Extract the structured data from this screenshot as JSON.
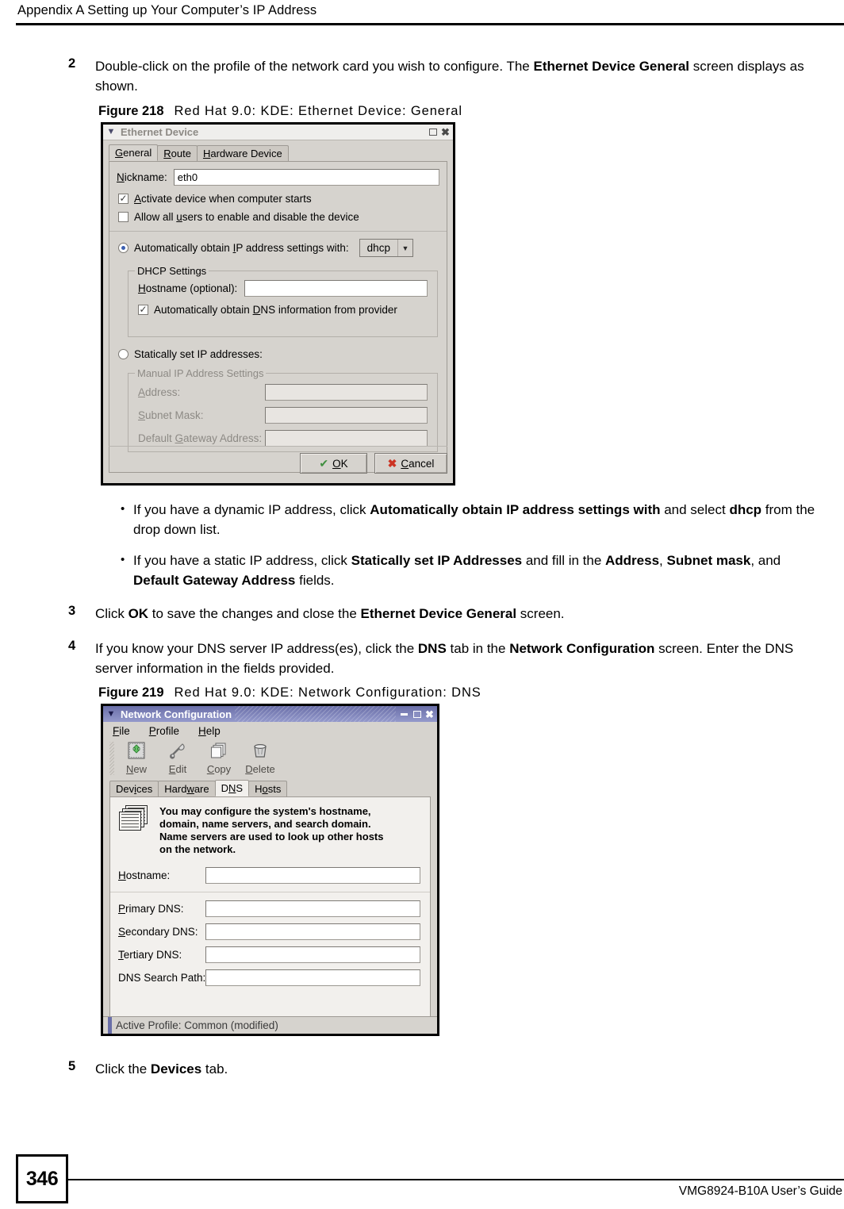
{
  "page": {
    "header": "Appendix A Setting up Your Computer’s IP Address",
    "footer_page_number": "346",
    "footer_guide": "VMG8924-B10A User’s Guide"
  },
  "steps": {
    "step2": {
      "number": "2",
      "text_1": "Double-click on the profile of the network card you wish to configure. The ",
      "bold_1": "Ethernet Device General",
      "text_2": " screen displays as shown."
    },
    "step3": {
      "number": "3",
      "text_1": "Click ",
      "bold_1": "OK",
      "text_2": " to save the changes and close the ",
      "bold_2": "Ethernet Device General",
      "text_3": " screen."
    },
    "step4": {
      "number": "4",
      "text_1": "If you know your DNS server IP address(es), click the ",
      "bold_1": "DNS",
      "text_2": " tab in the ",
      "bold_2": "Network Configuration",
      "text_3": " screen. Enter the DNS server information in the fields provided."
    },
    "step5": {
      "number": "5",
      "text_1": "Click the ",
      "bold_1": "Devices",
      "text_2": " tab."
    }
  },
  "bullets": [
    {
      "text_1": "If you have a dynamic IP address, click ",
      "bold_1": "Automatically obtain IP address settings with",
      "text_2": " and select ",
      "bold_2": "dhcp",
      "text_3": " from the drop down list."
    },
    {
      "text_1": "If you have a static IP address, click ",
      "bold_1": "Statically set IP Addresses",
      "text_2": " and fill in the  ",
      "bold_2": "Address",
      "text_3": ", ",
      "bold_3": "Subnet mask",
      "text_4": ", and ",
      "bold_4": "Default Gateway Address",
      "text_5": " fields."
    }
  ],
  "figures": {
    "fig218": {
      "label": "Figure 218",
      "caption": "Red Hat 9.0: KDE: Ethernet Device: General"
    },
    "fig219": {
      "label": "Figure 219",
      "caption": "Red Hat 9.0: KDE: Network Configuration: DNS"
    }
  },
  "ethernet_device_dialog": {
    "title": "Ethernet Device",
    "tabs": [
      {
        "label": "General",
        "mnemonic": "G",
        "active": true
      },
      {
        "label": "Route",
        "mnemonic": "R",
        "active": false
      },
      {
        "label": "Hardware Device",
        "mnemonic": "H",
        "active": false
      }
    ],
    "nickname_label": "Nickname:",
    "nickname_value": "eth0",
    "activate_checkbox_label": "Activate device when computer starts",
    "activate_checked": true,
    "allow_users_checkbox_label": "Allow all users to enable and disable the device",
    "allow_users_checked": false,
    "auto_radio_label": "Automatically obtain IP address settings with:",
    "auto_radio_selected": true,
    "protocol_combo_value": "dhcp",
    "dhcp_group_title": "DHCP Settings",
    "hostname_label": "Hostname (optional):",
    "hostname_value": "",
    "auto_dns_checkbox_label": "Automatically obtain DNS information from provider",
    "auto_dns_checked": true,
    "static_radio_label": "Statically set IP addresses:",
    "static_radio_selected": false,
    "manual_group_title": "Manual IP Address Settings",
    "address_label": "Address:",
    "address_value": "",
    "subnet_label": "Subnet Mask:",
    "subnet_value": "",
    "gateway_label": "Default Gateway Address:",
    "gateway_value": "",
    "ok_button": "OK",
    "cancel_button": "Cancel"
  },
  "network_config_dialog": {
    "title": "Network Configuration",
    "menus": [
      {
        "label": "File",
        "mnemonic": "F"
      },
      {
        "label": "Profile",
        "mnemonic": "P"
      },
      {
        "label": "Help",
        "mnemonic": "H"
      }
    ],
    "toolbar": [
      {
        "label": "New",
        "icon": "new-device-icon"
      },
      {
        "label": "Edit",
        "icon": "wrench-icon"
      },
      {
        "label": "Copy",
        "icon": "copy-pages-icon"
      },
      {
        "label": "Delete",
        "icon": "trash-can-icon"
      }
    ],
    "tabs": [
      {
        "label": "Devices",
        "active": false
      },
      {
        "label": "Hardware",
        "active": false
      },
      {
        "label": "DNS",
        "active": true
      },
      {
        "label": "Hosts",
        "active": false
      }
    ],
    "description": "You may configure the system's hostname, domain, name servers, and search domain. Name servers are used to look up other hosts on the network.",
    "fields": [
      {
        "label": "Hostname:",
        "value": ""
      },
      {
        "label": "Primary DNS:",
        "value": ""
      },
      {
        "label": "Secondary DNS:",
        "value": ""
      },
      {
        "label": "Tertiary DNS:",
        "value": ""
      },
      {
        "label": "DNS Search Path:",
        "value": ""
      }
    ],
    "statusbar": "Active Profile: Common (modified)"
  },
  "colors": {
    "widget_face": "#d6d3ce",
    "titlebar_active": "#7d82b8",
    "titlebar_inactive": "#efeeec",
    "radio_dot": "#3b5fb0",
    "ok_check": "#3f8f3f",
    "cancel_x": "#cc3322"
  }
}
